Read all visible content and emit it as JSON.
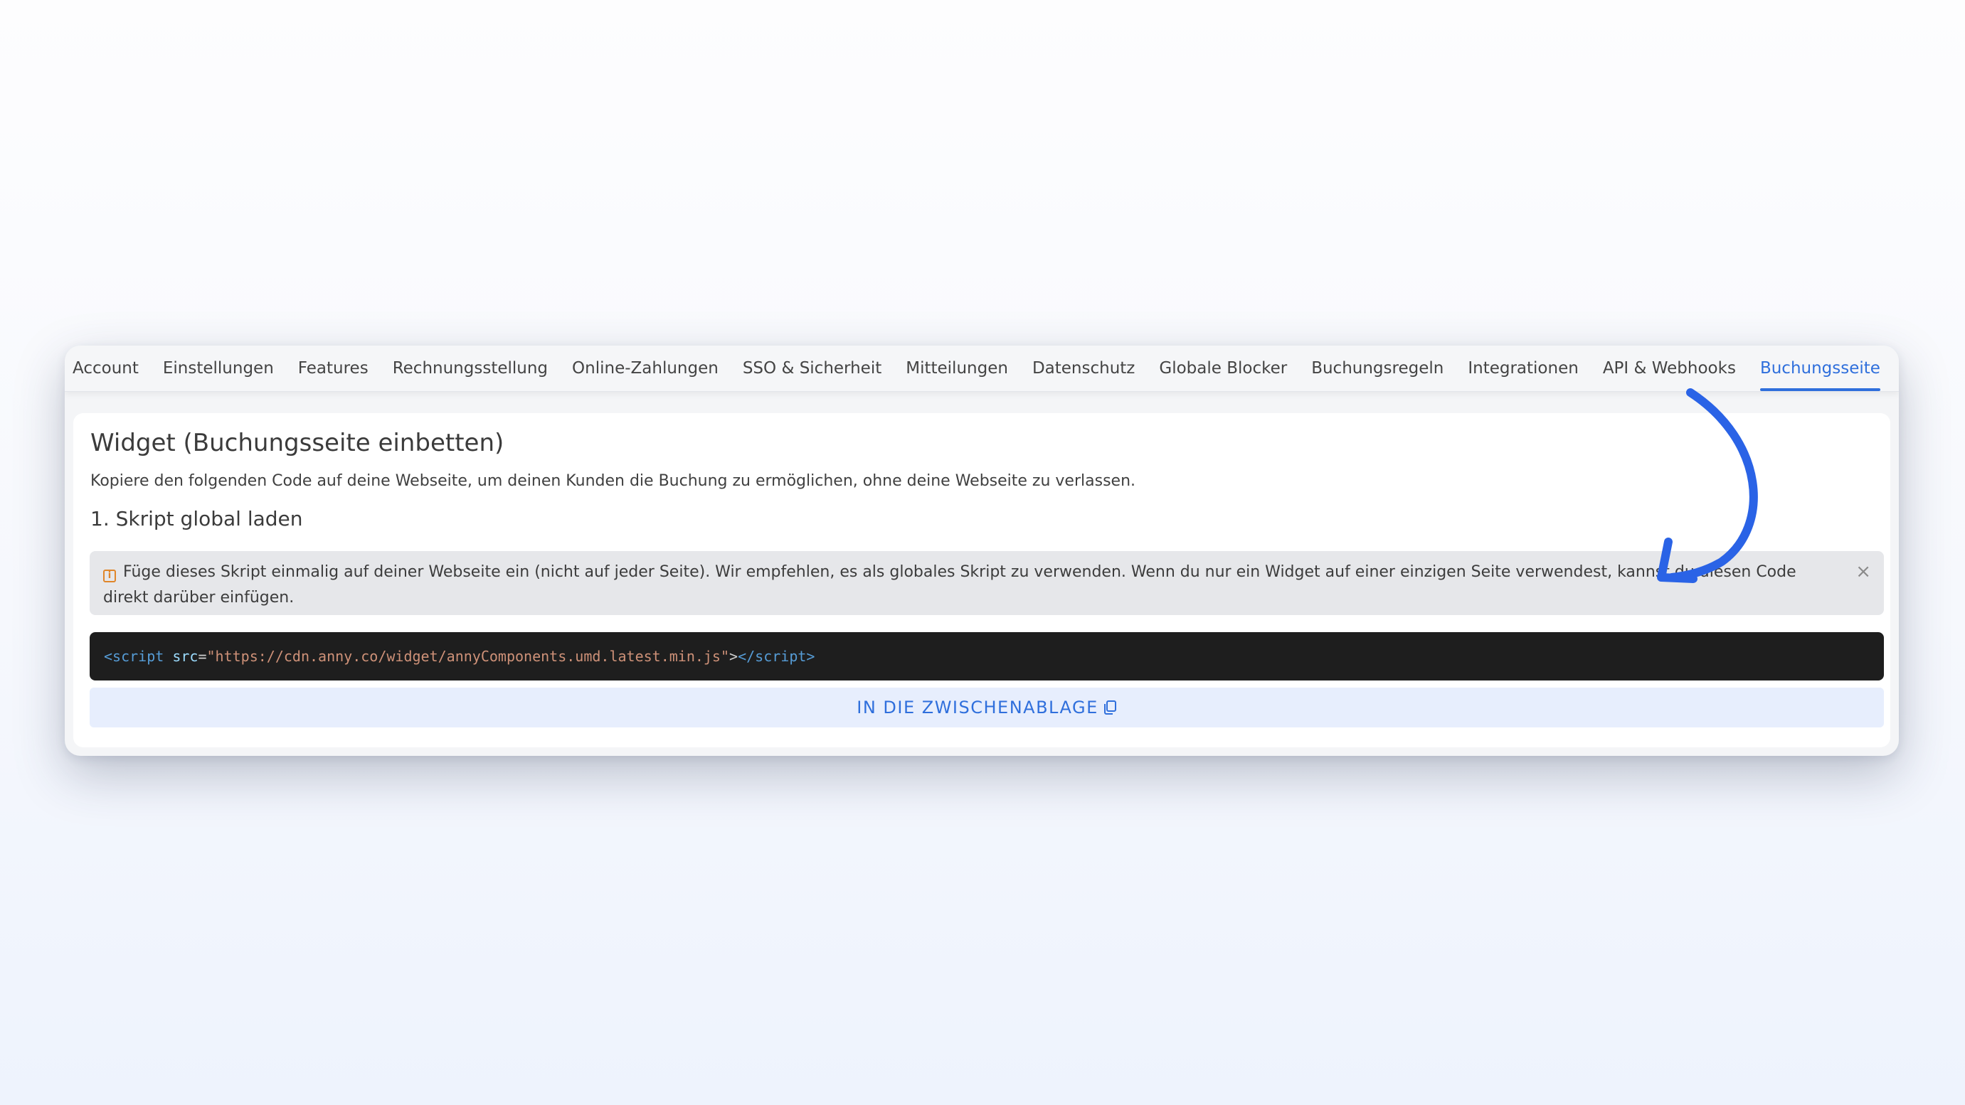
{
  "tabs": [
    {
      "label": "Account",
      "active": false
    },
    {
      "label": "Einstellungen",
      "active": false
    },
    {
      "label": "Features",
      "active": false
    },
    {
      "label": "Rechnungsstellung",
      "active": false
    },
    {
      "label": "Online-Zahlungen",
      "active": false
    },
    {
      "label": "SSO & Sicherheit",
      "active": false
    },
    {
      "label": "Mitteilungen",
      "active": false
    },
    {
      "label": "Datenschutz",
      "active": false
    },
    {
      "label": "Globale Blocker",
      "active": false
    },
    {
      "label": "Buchungsregeln",
      "active": false
    },
    {
      "label": "Integrationen",
      "active": false
    },
    {
      "label": "API & Webhooks",
      "active": false
    },
    {
      "label": "Buchungsseite",
      "active": true
    }
  ],
  "card": {
    "title": "Widget (Buchungsseite einbetten)",
    "description": "Kopiere den folgenden Code auf deine Webseite, um deinen Kunden die Buchung zu ermöglichen, ohne deine Webseite zu verlassen.",
    "section_title": "1. Skript global laden"
  },
  "alert": {
    "icon": "info-icon",
    "text": "Füge dieses Skript einmalig auf deiner Webseite ein (nicht auf jeder Seite). Wir empfehlen, es als globales Skript zu verwenden. Wenn du nur ein Widget auf einer einzigen Seite verwendest, kannst du diesen Code direkt darüber einfügen.",
    "close_icon": "close-icon",
    "close_glyph": "×"
  },
  "code": {
    "open_tag": "<script",
    "attr_name": "src",
    "equals": "=",
    "attr_value": "\"https://cdn.anny.co/widget/annyComponents.umd.latest.min.js\"",
    "gt": ">",
    "close_tag": "</script",
    "end_gt": ">"
  },
  "copy_button": {
    "label": "IN DIE ZWISCHENABLAGE",
    "icon": "copy-icon"
  },
  "colors": {
    "accent": "#2f6fdc",
    "annotation_arrow": "#2a63e6",
    "alert_icon": "#e0862a",
    "code_background": "#1e1e1e"
  }
}
